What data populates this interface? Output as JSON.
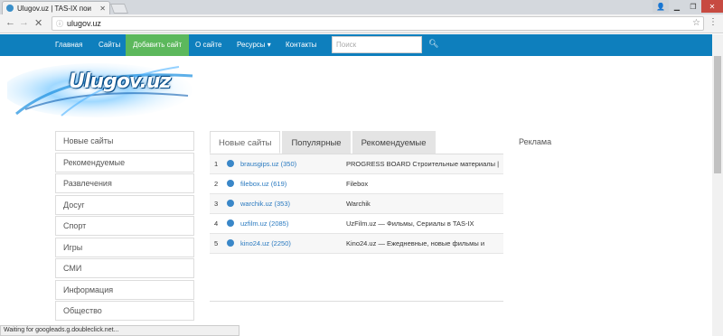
{
  "browser": {
    "tab_title": "Ulugov.uz | TAS-IX пои",
    "url": "ulugov.uz",
    "status_text": "Waiting for googleads.g.doubleclick.net..."
  },
  "nav": {
    "items": [
      "Главная",
      "Сайты",
      "Добавить сайт",
      "О сайте",
      "Ресурсы ▾",
      "Контакты"
    ],
    "search_placeholder": "Поиск"
  },
  "logo": {
    "text": "Ulugov.uz"
  },
  "sidebar": {
    "items": [
      "Новые сайты",
      "Рекомендуемые",
      "Развлечения",
      "Досуг",
      "Спорт",
      "Игры",
      "СМИ",
      "Информация",
      "Общество"
    ]
  },
  "content_tabs": [
    "Новые сайты",
    "Популярные",
    "Рекомендуемые"
  ],
  "sites": [
    {
      "rank": "1",
      "link": "brausgips.uz (350)",
      "desc": "PROGRESS BOARD Строительные материалы |"
    },
    {
      "rank": "2",
      "link": "filebox.uz (619)",
      "desc": "Filebox"
    },
    {
      "rank": "3",
      "link": "warchik.uz (353)",
      "desc": "Warchik"
    },
    {
      "rank": "4",
      "link": "uzfilm.uz (2085)",
      "desc": "UzFilm.uz — Фильмы, Сериалы в TAS-IX"
    },
    {
      "rank": "5",
      "link": "kino24.uz (2250)",
      "desc": "Kino24.uz — Ежедневные, новые фильмы и"
    }
  ],
  "ad_label": "Реклама"
}
